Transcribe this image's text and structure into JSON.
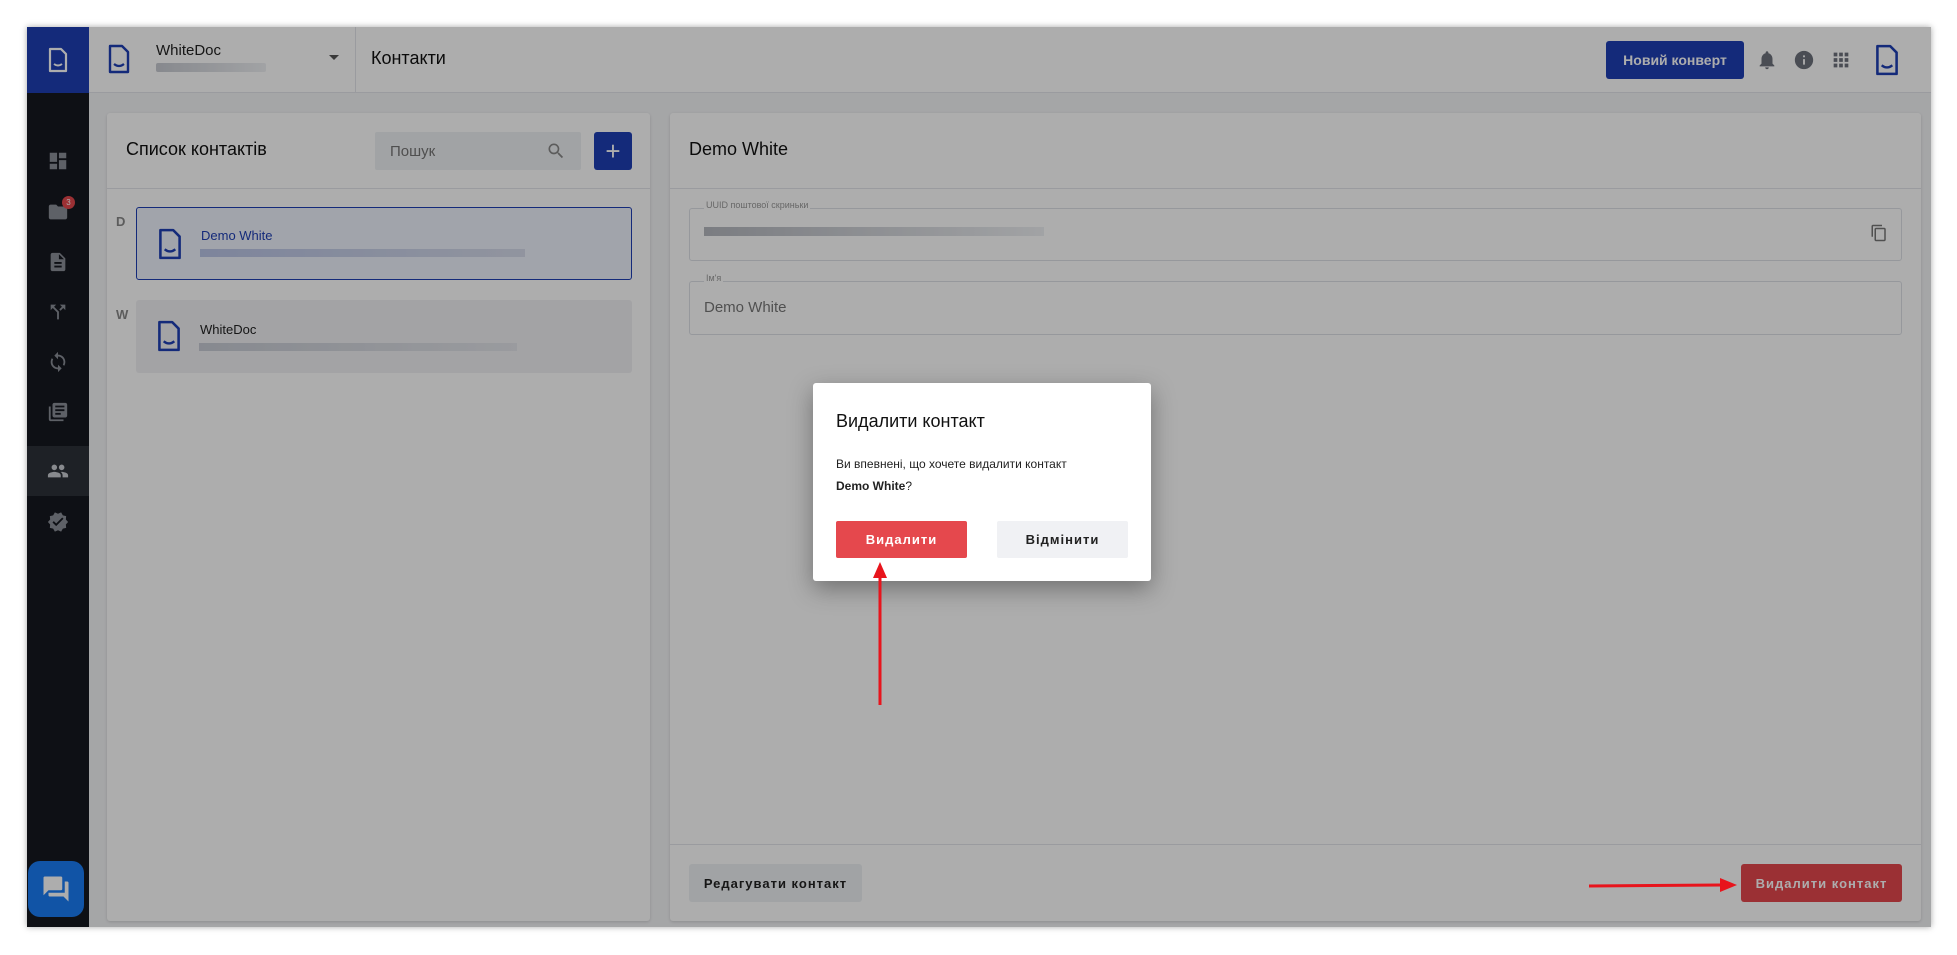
{
  "header": {
    "org_name": "WhiteDoc",
    "page_title": "Контакти",
    "new_envelope_label": "Новий конверт"
  },
  "sidebar": {
    "items": [
      {
        "icon": "dashboard-icon"
      },
      {
        "icon": "folder-icon",
        "badge": "3"
      },
      {
        "icon": "document-icon"
      },
      {
        "icon": "workflow-icon"
      },
      {
        "icon": "sync-icon"
      },
      {
        "icon": "library-icon"
      },
      {
        "icon": "contacts-icon",
        "active": true
      },
      {
        "icon": "verified-icon"
      }
    ]
  },
  "contacts_list": {
    "title": "Список контактів",
    "search_placeholder": "Пошук",
    "add_label": "+",
    "groups": [
      {
        "letter": "D",
        "name": "Demo White",
        "selected": true
      },
      {
        "letter": "W",
        "name": "WhiteDoc",
        "selected": false
      }
    ]
  },
  "detail": {
    "title": "Demo White",
    "mailbox_uuid_label": "UUID поштової скриньки",
    "name_label": "Ім'я",
    "name_value": "Demo White",
    "edit_label": "Редагувати контакт",
    "delete_label": "Видалити контакт"
  },
  "modal": {
    "title": "Видалити контакт",
    "text_prefix": "Ви впевнені, що хочете видалити контакт",
    "contact_name": "Demo White",
    "text_suffix": "?",
    "confirm_label": "Видалити",
    "cancel_label": "Відмінити"
  },
  "colors": {
    "brand": "#1e3fb4",
    "danger": "#e5484d",
    "annotation": "#e8141c"
  }
}
